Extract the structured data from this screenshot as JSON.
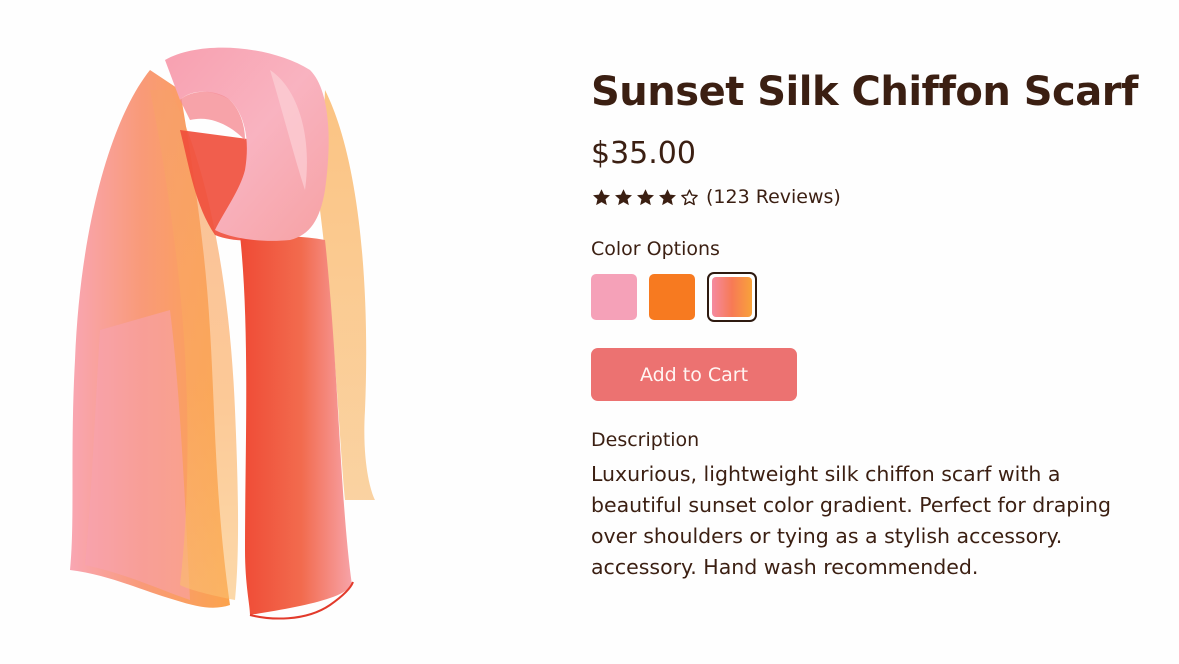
{
  "product": {
    "title": "Sunset Silk Chiffon Scarf",
    "price": "$35.00",
    "rating": {
      "value": 4,
      "max": 5,
      "reviews_text": "(123 Reviews)"
    },
    "color_options_label": "Color Options",
    "colors": [
      {
        "name": "pink",
        "hex": "#f5a1b8",
        "selected": false
      },
      {
        "name": "orange",
        "hex": "#f77a20",
        "selected": false
      },
      {
        "name": "sunset-gradient",
        "hex": "#f58aa0",
        "selected": true
      }
    ],
    "add_to_cart_label": "Add to Cart",
    "description_label": "Description",
    "description": "Luxurious, lightweight silk chiffon scarf with a beautiful sunset color gradient. Perfect for draping over shoulders or tying as a stylish accessory. accessory. Hand wash recommended."
  },
  "colors": {
    "text": "#3b1f12",
    "button": "#ec7271",
    "button_text": "#fff5f2"
  }
}
